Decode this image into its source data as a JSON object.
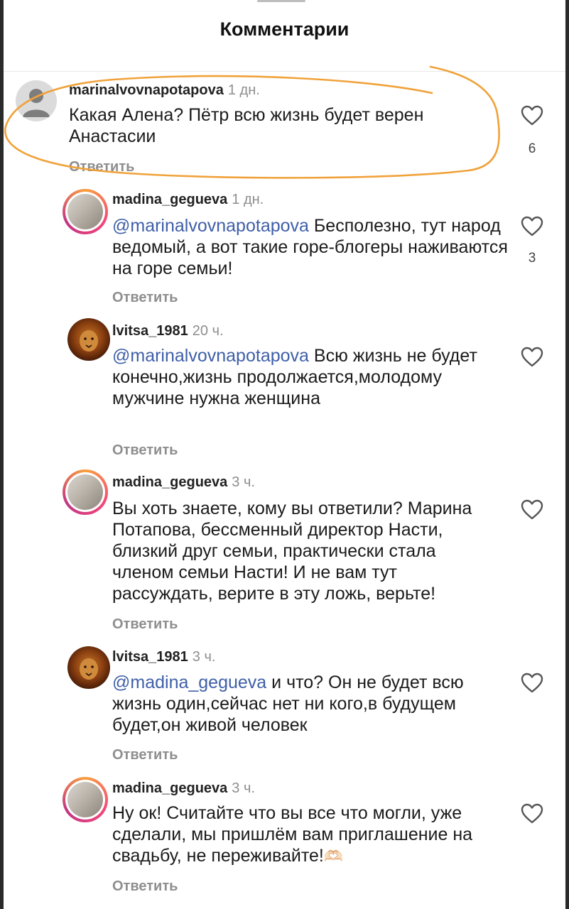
{
  "header": {
    "title": "Комментарии"
  },
  "comments": [
    {
      "username": "marinalvovnapotapova",
      "time": "1 дн.",
      "mention": "",
      "text": "Какая Алена?  Пётр всю жизнь будет верен Анастасии",
      "reply": "Ответить",
      "likes": "6",
      "avatar": "default-avatar"
    },
    {
      "username": "madina_gegueva",
      "time": "1 дн.",
      "mention": "@marinalvovnapotapova",
      "text": "Бесполезно, тут народ ведомый, а вот такие горе-блогеры наживаются на горе семьи!",
      "reply": "Ответить",
      "likes": "3",
      "avatar": "story-ring-avatar"
    },
    {
      "username": "lvitsa_1981",
      "time": "20 ч.",
      "mention": "@marinalvovnapotapova",
      "text": "Всю жизнь не будет конечно,жизнь продолжается,молодому мужчине нужна женщина",
      "reply": "Ответить",
      "likes": "",
      "avatar": "lion-avatar"
    },
    {
      "username": "madina_gegueva",
      "time": "3 ч.",
      "mention": "",
      "text": "Вы хоть знаете, кому вы ответили? Марина Потапова, бессменный директор Насти, близкий друг семьи, практически стала членом семьи Насти! И не вам тут рассуждать, верите в эту ложь, верьте!",
      "reply": "Ответить",
      "likes": "",
      "avatar": "story-ring-avatar"
    },
    {
      "username": "lvitsa_1981",
      "time": "3 ч.",
      "mention": "@madina_gegueva",
      "text": "и что? Он не будет всю жизнь один,сейчас нет ни кого,в будущем будет,он живой человек",
      "reply": "Ответить",
      "likes": "",
      "avatar": "lion-avatar"
    },
    {
      "username": "madina_gegueva",
      "time": "3 ч.",
      "mention": "",
      "text": "Ну ок! Считайте что вы все что могли, уже сделали, мы пришлём вам приглашение на свадьбу, не переживайте!",
      "emoji": "🫶🏻",
      "reply": "Ответить",
      "likes": "",
      "avatar": "story-ring-avatar"
    }
  ],
  "colors": {
    "mention": "#3f5fa8",
    "annotation": "#f0a23a",
    "muted": "#8e8e8e"
  }
}
